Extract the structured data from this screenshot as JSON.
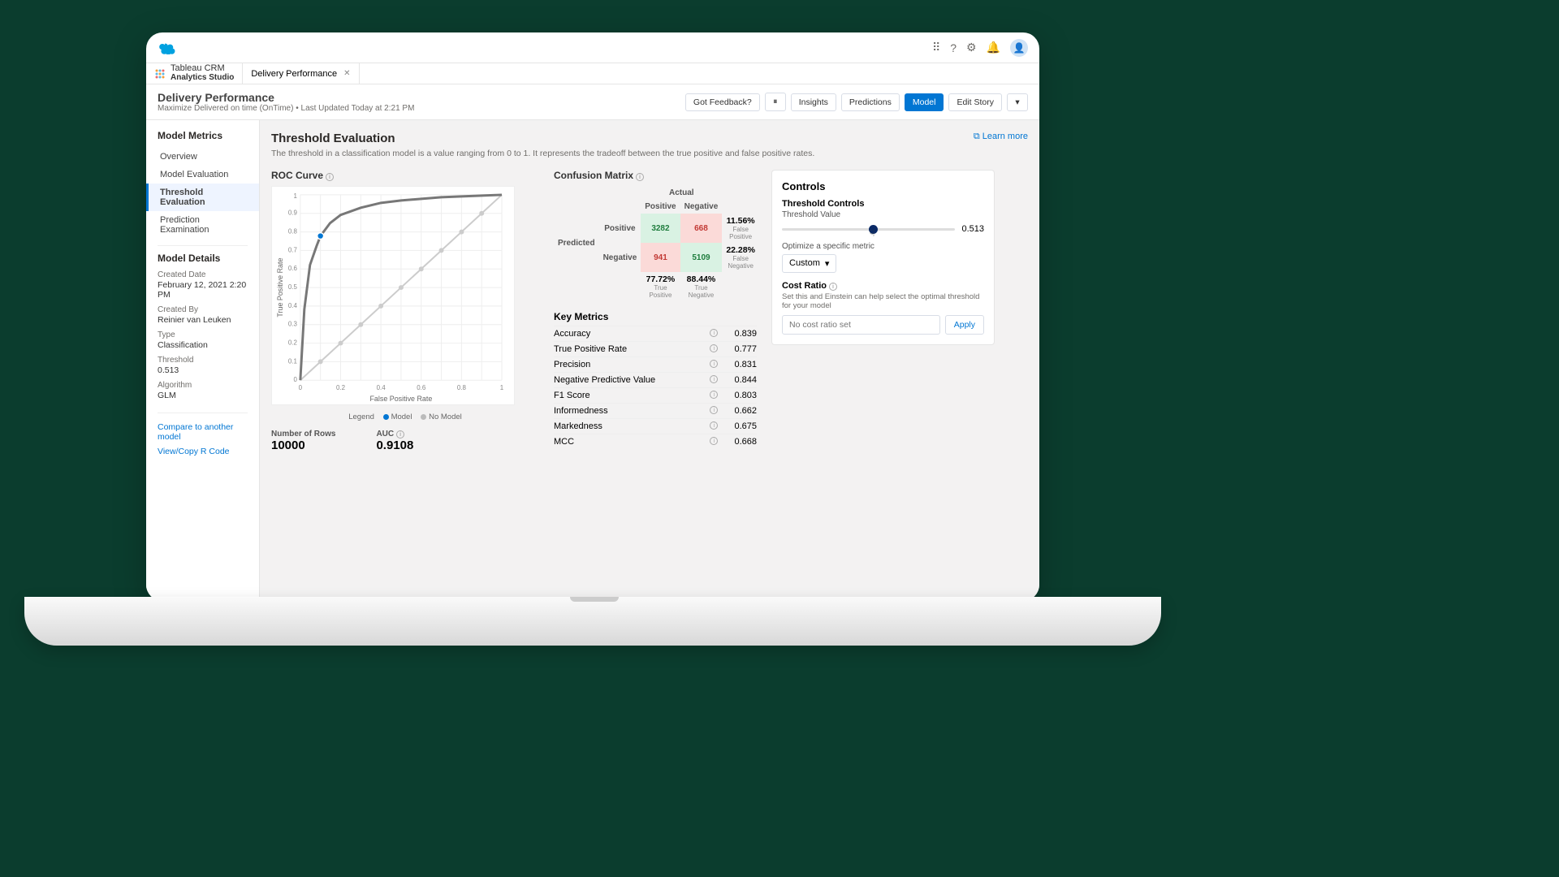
{
  "app": {
    "name": "Tableau CRM",
    "sub": "Analytics Studio"
  },
  "tab": {
    "title": "Delivery Performance"
  },
  "header": {
    "title": "Delivery Performance",
    "subtitle": "Maximize Delivered on time (OnTime) • Last Updated Today at 2:21 PM",
    "buttons": {
      "feedback": "Got Feedback?",
      "insights": "Insights",
      "predictions": "Predictions",
      "model": "Model",
      "editStory": "Edit Story"
    }
  },
  "sidebar": {
    "heading": "Model Metrics",
    "items": [
      "Overview",
      "Model Evaluation",
      "Threshold Evaluation",
      "Prediction Examination"
    ],
    "activeIndex": 2,
    "detailsHeading": "Model Details",
    "details": {
      "createdDateLabel": "Created Date",
      "createdDate": "February 12, 2021 2:20 PM",
      "createdByLabel": "Created By",
      "createdBy": "Reinier van Leuken",
      "typeLabel": "Type",
      "type": "Classification",
      "thresholdLabel": "Threshold",
      "threshold": "0.513",
      "algorithmLabel": "Algorithm",
      "algorithm": "GLM"
    },
    "links": {
      "compare": "Compare to another model",
      "viewCode": "View/Copy R Code"
    }
  },
  "main": {
    "learnMore": "Learn more",
    "title": "Threshold Evaluation",
    "description": "The threshold in a classification model is a value ranging from 0 to 1. It represents the tradeoff between the true positive and false positive rates."
  },
  "roc": {
    "title": "ROC Curve",
    "xlabel": "False Positive Rate",
    "ylabel": "True Positive Rate",
    "legendLabel": "Legend",
    "legendModel": "Model",
    "legendNoModel": "No Model",
    "numRowsLabel": "Number of Rows",
    "numRows": "10000",
    "aucLabel": "AUC",
    "auc": "0.9108",
    "ticks": [
      "0",
      "0.1",
      "0.2",
      "0.3",
      "0.4",
      "0.5",
      "0.6",
      "0.7",
      "0.8",
      "0.9",
      "1"
    ]
  },
  "confusion": {
    "title": "Confusion Matrix",
    "actual": "Actual",
    "predicted": "Predicted",
    "positive": "Positive",
    "negative": "Negative",
    "tp": "3282",
    "fp": "668",
    "fn": "941",
    "tn": "5109",
    "fpPct": "11.56%",
    "fpPctLabel": "False Positive",
    "fnPct": "22.28%",
    "fnPctLabel": "False Negative",
    "tpPct": "77.72%",
    "tpPctLabel": "True Positive",
    "tnPct": "88.44%",
    "tnPctLabel": "True Negative"
  },
  "keyMetrics": {
    "title": "Key Metrics",
    "rows": [
      {
        "label": "Accuracy",
        "value": "0.839"
      },
      {
        "label": "True Positive Rate",
        "value": "0.777"
      },
      {
        "label": "Precision",
        "value": "0.831"
      },
      {
        "label": "Negative Predictive Value",
        "value": "0.844"
      },
      {
        "label": "F1 Score",
        "value": "0.803"
      },
      {
        "label": "Informedness",
        "value": "0.662"
      },
      {
        "label": "Markedness",
        "value": "0.675"
      },
      {
        "label": "MCC",
        "value": "0.668"
      }
    ]
  },
  "controls": {
    "title": "Controls",
    "thresholdControls": "Threshold Controls",
    "thresholdValueLabel": "Threshold Value",
    "thresholdValue": "0.513",
    "optimizeLabel": "Optimize a specific metric",
    "optimizeSelected": "Custom",
    "costRatioLabel": "Cost Ratio",
    "costRatioDesc": "Set this and Einstein can help select the optimal threshold for your model",
    "costRatioPlaceholder": "No cost ratio set",
    "applyLabel": "Apply"
  },
  "chart_data": {
    "type": "line",
    "title": "ROC Curve",
    "xlabel": "False Positive Rate",
    "ylabel": "True Positive Rate",
    "xlim": [
      0,
      1
    ],
    "ylim": [
      0,
      1
    ],
    "series": [
      {
        "name": "Model",
        "x": [
          0,
          0.02,
          0.05,
          0.08,
          0.1,
          0.15,
          0.2,
          0.3,
          0.4,
          0.5,
          0.6,
          0.7,
          0.8,
          0.9,
          1.0
        ],
        "y": [
          0,
          0.38,
          0.62,
          0.72,
          0.78,
          0.85,
          0.89,
          0.93,
          0.955,
          0.97,
          0.98,
          0.985,
          0.99,
          0.995,
          1.0
        ]
      },
      {
        "name": "No Model",
        "x": [
          0,
          1
        ],
        "y": [
          0,
          1
        ]
      }
    ],
    "highlight_point": {
      "x": 0.1,
      "y": 0.78
    },
    "auc": 0.9108
  }
}
